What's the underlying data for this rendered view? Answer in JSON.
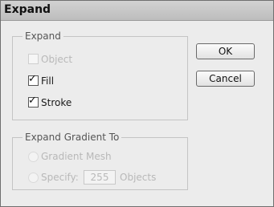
{
  "dialog": {
    "title": "Expand"
  },
  "expand_group": {
    "legend": "Expand",
    "object": {
      "label": "Object",
      "checked": false,
      "enabled": false
    },
    "fill": {
      "label": "Fill",
      "checked": true,
      "enabled": true
    },
    "stroke": {
      "label": "Stroke",
      "checked": true,
      "enabled": true
    }
  },
  "gradient_group": {
    "legend": "Expand Gradient To",
    "gradient_mesh": {
      "label": "Gradient Mesh",
      "enabled": false
    },
    "specify": {
      "label": "Specify:",
      "value": "255",
      "suffix": "Objects",
      "enabled": false
    }
  },
  "buttons": {
    "ok": "OK",
    "cancel": "Cancel"
  },
  "icons": {
    "checkmark": "check-icon"
  },
  "colors": {
    "dialog_bg": "#ececec",
    "disabled_text": "#b8b8b8"
  }
}
